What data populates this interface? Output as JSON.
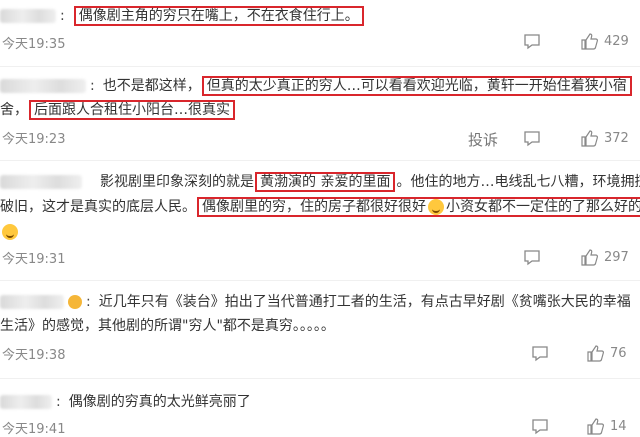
{
  "comments": [
    {
      "segments": [
        "偶像剧主角的穷只在嘴上，不在衣食住行上。"
      ],
      "time": "今天19:35",
      "likes": "429"
    },
    {
      "line1_plain": "也不是都这样，",
      "line1_hl": "但真的太少真正的穷人…可以看看欢迎光临，黄轩一开始住着狭小宿",
      "line2_hl_a": "舍，",
      "line2_hl_b": "后面跟人合租住小阳台…很真实",
      "time": "今天19:23",
      "report": "投诉",
      "likes": "372"
    },
    {
      "line1_plain": "影视剧里印象深刻的就是",
      "line1_hl": "黄渤演的 亲爱的里面",
      "line1_rest": "。他住的地方…电线乱七八糟，环境拥挤",
      "line2_plain": "破旧，这才是真实的底层人民。",
      "line2_hl": "偶像剧里的穷，住的房子都很好很好",
      "line2_rest": "小资女都不一定住的了那么好的",
      "time": "今天19:31",
      "likes": "297"
    },
    {
      "line1": "近几年只有《装台》拍出了当代普通打工者的生活，有点古早好剧《贫嘴张大民的幸福",
      "line2": "生活》的感觉，其他剧的所谓\"穷人\"都不是真穷。。。。。",
      "time": "今天19:38",
      "likes": "76"
    },
    {
      "line1": "偶像剧的穷真的太光鲜亮丽了",
      "time": "今天19:41",
      "likes": "14"
    }
  ],
  "colors": {
    "highlight_border": "#d9262c",
    "meta_text": "#888888"
  },
  "icons": {
    "comment": "comment-icon",
    "like": "thumbs-up-icon"
  }
}
